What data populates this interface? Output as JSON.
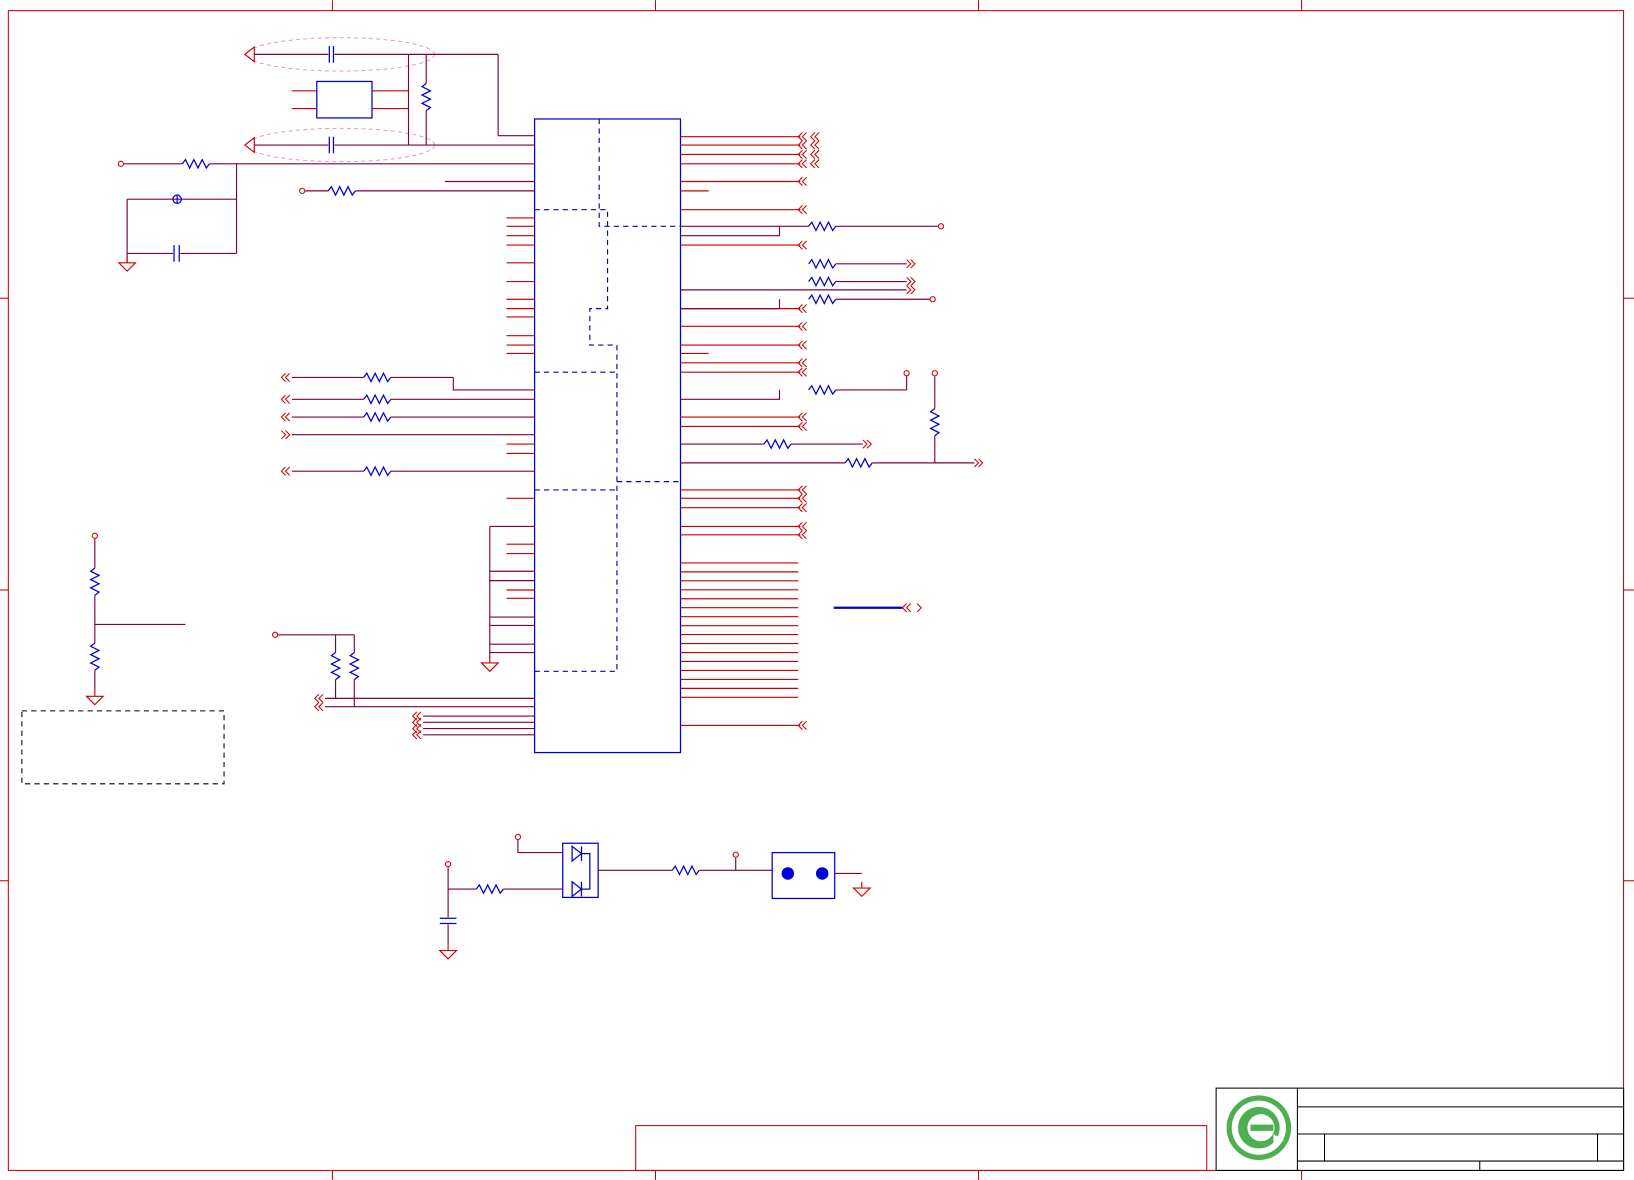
{
  "sheet": {
    "colors": {
      "wire": "#cc0000",
      "net": "#800040",
      "component": "#0000cc",
      "frame": "#cc0000",
      "logo_green": "#4caf50"
    },
    "title_block": {
      "logo_icon": "green-e-logo-icon"
    }
  }
}
